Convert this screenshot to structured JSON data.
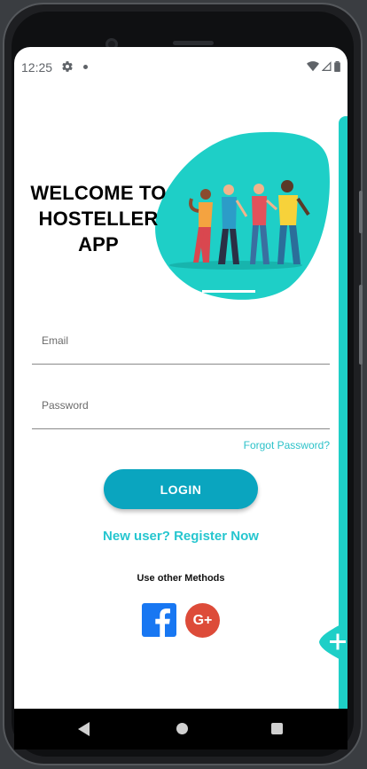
{
  "status_bar": {
    "time": "12:25",
    "icons": [
      "settings-gear-icon",
      "notification-dot-icon",
      "wifi-icon",
      "signal-icon",
      "battery-icon"
    ]
  },
  "welcome": {
    "line1": "WELCOME TO",
    "line2": "HOSTELLER",
    "line3": "APP"
  },
  "form": {
    "email_placeholder": "Email",
    "email_value": "",
    "password_placeholder": "Password",
    "password_value": "",
    "forgot_label": "Forgot Password?",
    "login_label": "LOGIN"
  },
  "register_label": "New user? Register Now",
  "other_methods_label": "Use other Methods",
  "social": {
    "facebook_icon": "facebook-icon",
    "google_label": "G+"
  },
  "colors": {
    "accent": "#1ecfc7",
    "button": "#0aa5bf",
    "link": "#2cc2c9",
    "facebook": "#1877f2",
    "google": "#dd4b39"
  }
}
